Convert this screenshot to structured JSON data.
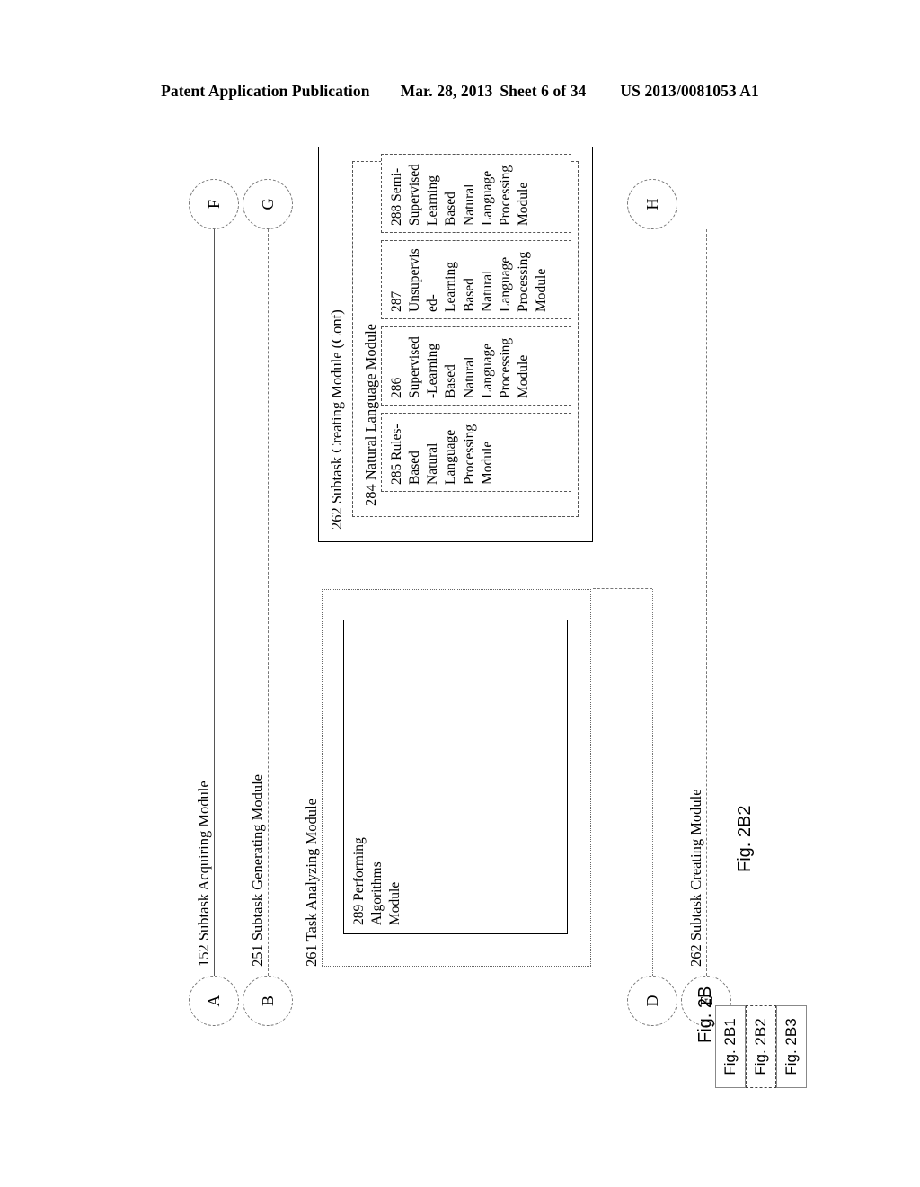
{
  "header": {
    "publication": "Patent Application Publication",
    "date": "Mar. 28, 2013",
    "sheet": "Sheet 6 of 34",
    "patent_number": "US 2013/0081053 A1"
  },
  "figure": {
    "caption_main": "Fig. 2B2",
    "key_label": "Fig. 2B",
    "key_cells": [
      {
        "label": "Fig. 2B1",
        "current": false
      },
      {
        "label": "Fig. 2B2",
        "current": true
      },
      {
        "label": "Fig. 2B3",
        "current": false
      }
    ]
  },
  "connectors": {
    "top": [
      {
        "id": "F",
        "label": "F"
      },
      {
        "id": "G",
        "label": "G"
      },
      {
        "id": "H",
        "label": "H"
      }
    ],
    "bottom": [
      {
        "id": "A",
        "label": "A"
      },
      {
        "id": "B",
        "label": "B"
      },
      {
        "id": "D",
        "label": "D"
      },
      {
        "id": "E",
        "label": "E"
      }
    ]
  },
  "lane_labels": {
    "subtask_acquiring": "152 Subtask Acquiring Module",
    "subtask_generating": "251 Subtask Generating Module",
    "task_analyzing": "261 Task Analyzing Module",
    "subtask_creating_right": "262 Subtask Creating Module"
  },
  "boxes": {
    "subtask_creating_cont": {
      "label": "262 Subtask Creating Module (Cont)"
    },
    "natural_language_module": {
      "label": "284 Natural Language Module"
    },
    "rules_based": {
      "label": "285 Rules-\nBased\nNatural\nLanguage\nProcessing\nModule"
    },
    "supervised_learning": {
      "label": "286\nSupervised\n-Learning\nBased\nNatural\nLanguage\nProcessing\nModule"
    },
    "unsupervised_learning": {
      "label": "287\nUnsupervis\ned-\nLearning\nBased\nNatural\nLanguage\nProcessing\nModule"
    },
    "semi_supervised_learning": {
      "label": "288 Semi-\nSupervised\nLearning Based\nNatural\nLanguage\nProcessing\nModule"
    },
    "performing_algorithms": {
      "label": "289 Performing\nAlgorithms\nModule"
    }
  }
}
